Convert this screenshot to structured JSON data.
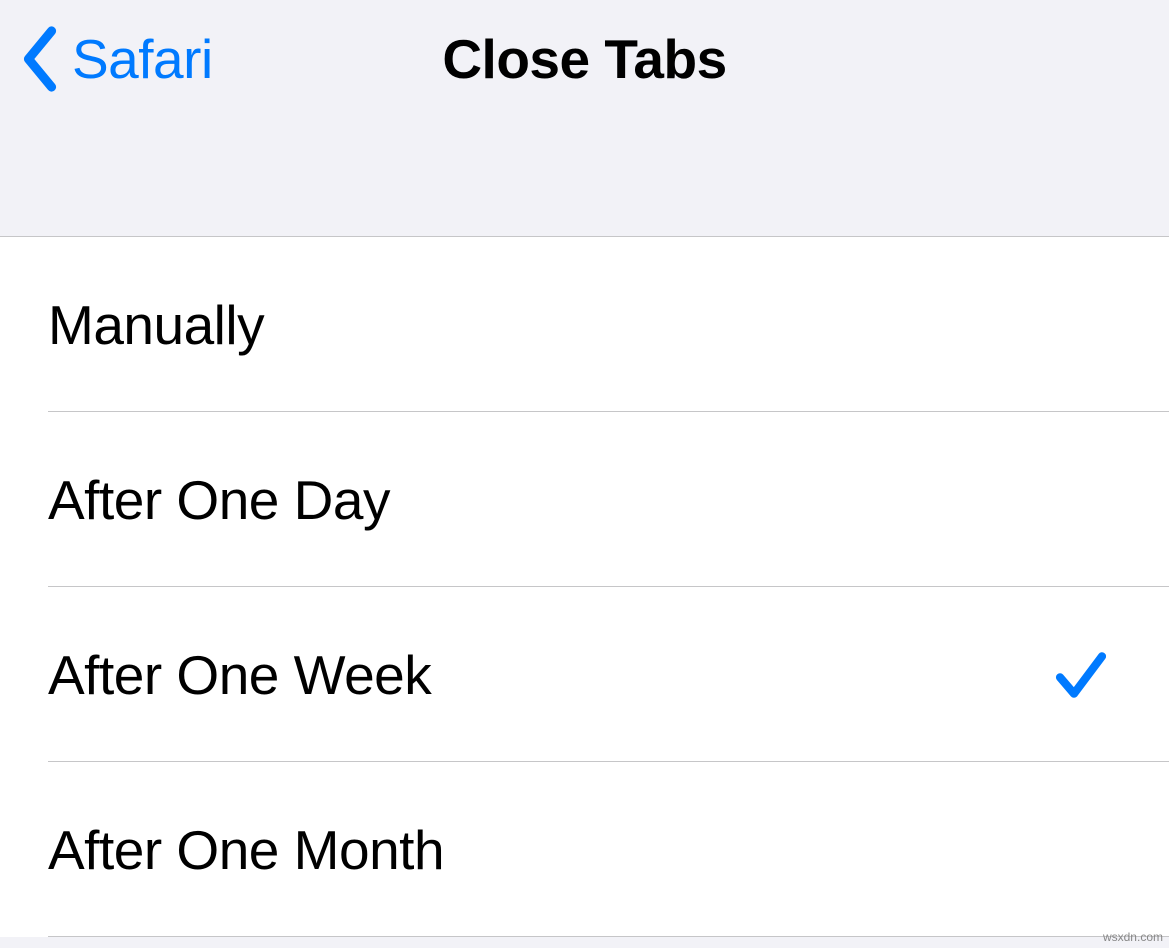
{
  "nav": {
    "back_label": "Safari",
    "title": "Close Tabs"
  },
  "options": [
    {
      "label": "Manually",
      "selected": false
    },
    {
      "label": "After One Day",
      "selected": false
    },
    {
      "label": "After One Week",
      "selected": true
    },
    {
      "label": "After One Month",
      "selected": false
    }
  ],
  "watermark": "wsxdn.com"
}
